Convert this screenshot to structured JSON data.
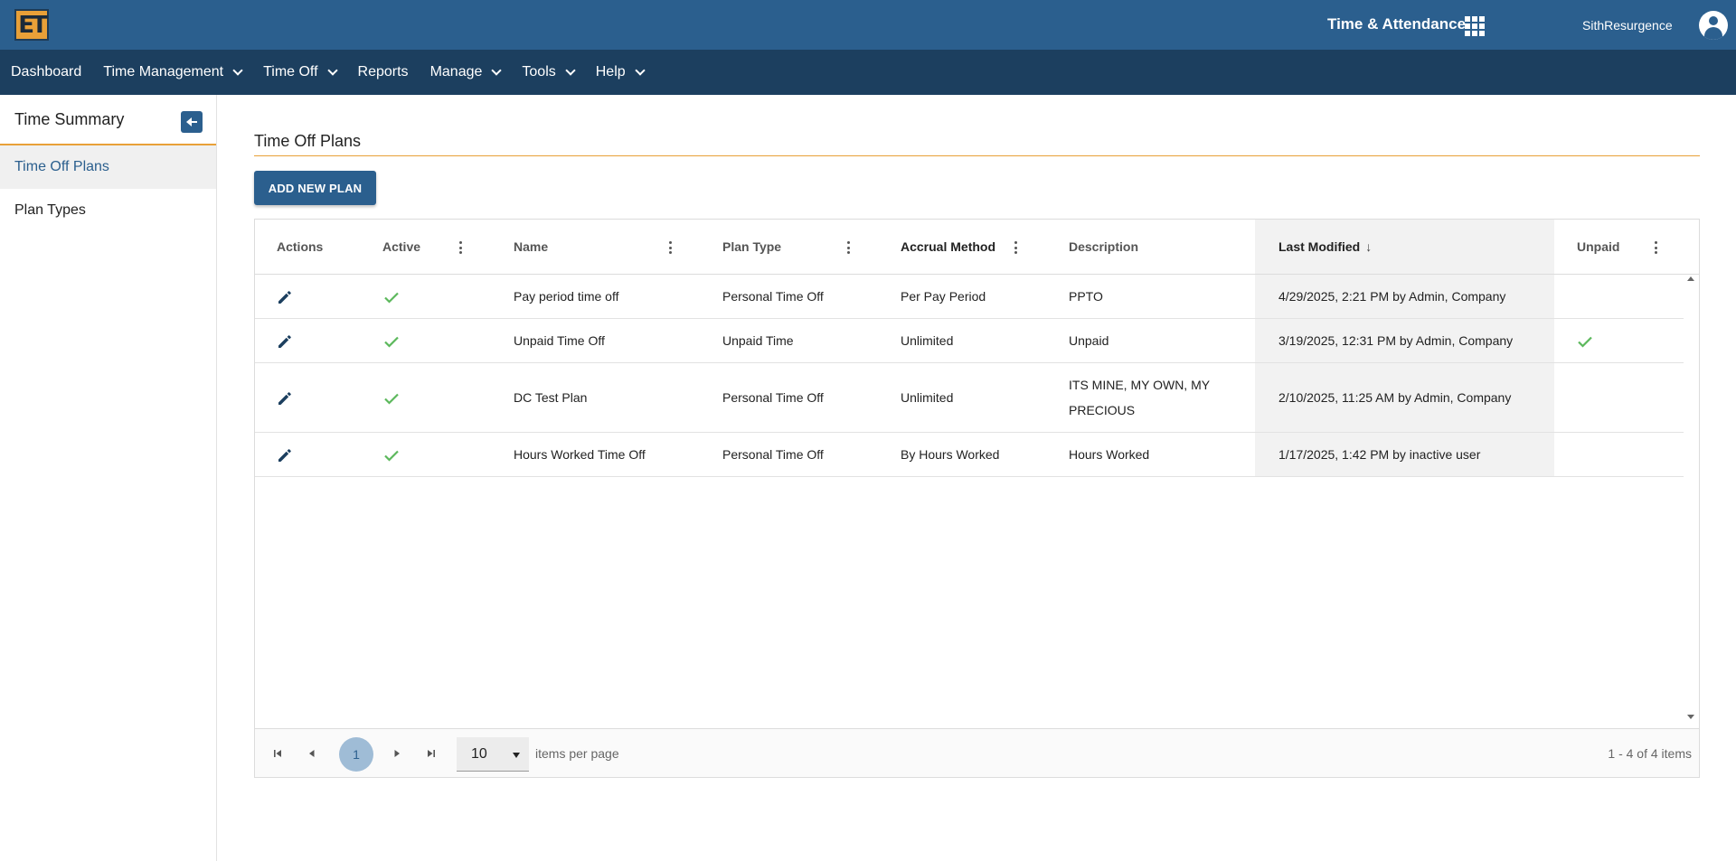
{
  "header": {
    "logo_text": "ET",
    "app_title": "Time & Attendance",
    "apps_icon": "grid-apps-icon",
    "username": "SithResurgence",
    "avatar_icon": "user-avatar-icon",
    "brand_color": "#2b5f8e",
    "accent_color": "#e8a038"
  },
  "nav": {
    "items": [
      {
        "label": "Dashboard",
        "dropdown": false
      },
      {
        "label": "Time Management",
        "dropdown": true
      },
      {
        "label": "Time Off",
        "dropdown": true
      },
      {
        "label": "Reports",
        "dropdown": false
      },
      {
        "label": "Manage",
        "dropdown": true
      },
      {
        "label": "Tools",
        "dropdown": true
      },
      {
        "label": "Help",
        "dropdown": true
      }
    ]
  },
  "sidebar": {
    "title": "Time Summary",
    "items": [
      {
        "label": "Time Off Plans",
        "active": true
      },
      {
        "label": "Plan Types",
        "active": false
      }
    ]
  },
  "main": {
    "title": "Time Off Plans",
    "add_button": "ADD NEW PLAN"
  },
  "table": {
    "columns": [
      {
        "key": "actions",
        "label": "Actions"
      },
      {
        "key": "active",
        "label": "Active"
      },
      {
        "key": "name",
        "label": "Name"
      },
      {
        "key": "plan_type",
        "label": "Plan Type"
      },
      {
        "key": "accrual",
        "label": "Accrual Method"
      },
      {
        "key": "description",
        "label": "Description"
      },
      {
        "key": "last_modified",
        "label": "Last Modified",
        "sort": "desc",
        "sort_arrow": "↓"
      },
      {
        "key": "unpaid",
        "label": "Unpaid"
      }
    ],
    "rows": [
      {
        "active": true,
        "name": "Pay period time off",
        "plan_type": "Personal Time Off",
        "accrual": "Per Pay Period",
        "description": "PPTO",
        "last_modified": "4/29/2025, 2:21 PM by Admin, Company",
        "unpaid": false
      },
      {
        "active": true,
        "name": "Unpaid Time Off",
        "plan_type": "Unpaid Time",
        "accrual": "Unlimited",
        "description": "Unpaid",
        "last_modified": "3/19/2025, 12:31 PM by Admin, Company",
        "unpaid": true
      },
      {
        "active": true,
        "name": "DC Test Plan",
        "plan_type": "Personal Time Off",
        "accrual": "Unlimited",
        "description": "ITS MINE, MY OWN, MY PRECIOUS",
        "last_modified": "2/10/2025, 11:25 AM by Admin, Company",
        "unpaid": false
      },
      {
        "active": true,
        "name": "Hours Worked Time Off",
        "plan_type": "Personal Time Off",
        "accrual": "By Hours Worked",
        "description": "Hours Worked",
        "last_modified": "1/17/2025, 1:42 PM by inactive user",
        "unpaid": false
      }
    ],
    "check_color": "#5cb85c"
  },
  "pager": {
    "current_page": "1",
    "page_size": "10",
    "page_size_label": "items per page",
    "info": "1 - 4 of 4 items"
  }
}
